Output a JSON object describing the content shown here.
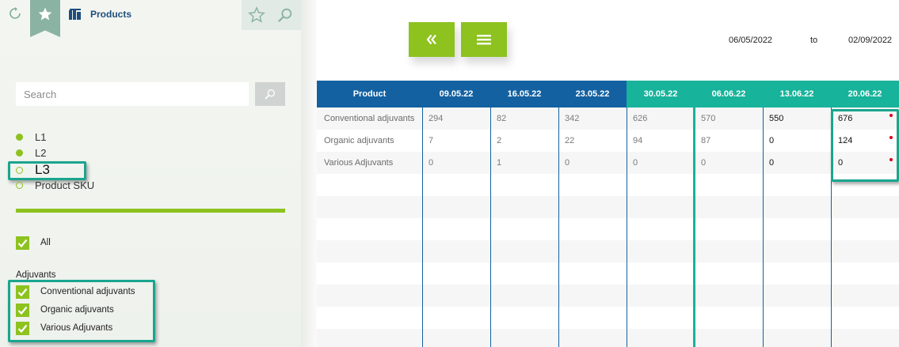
{
  "header": {
    "title": "Products",
    "refresh_icon": "refresh-icon",
    "favorite_icon": "star-icon",
    "products_icon": "products-icon",
    "star_outline_icon": "star-outline-icon",
    "search_icon": "search-icon"
  },
  "search": {
    "placeholder": "Search",
    "value": ""
  },
  "levels": [
    {
      "label": "L1",
      "selected": false
    },
    {
      "label": "L2",
      "selected": false
    },
    {
      "label": "L3",
      "selected": true
    },
    {
      "label": "Product SKU",
      "selected": false
    }
  ],
  "filters": {
    "all_label": "All",
    "group_label": "Adjuvants",
    "items": [
      {
        "label": "Conventional adjuvants",
        "checked": true
      },
      {
        "label": "Organic adjuvants",
        "checked": true
      },
      {
        "label": "Various Adjuvants",
        "checked": true
      }
    ]
  },
  "toolbar": {
    "collapse_icon": "double-chevron-left-icon",
    "menu_icon": "menu-icon"
  },
  "date_range": {
    "from": "06/05/2022",
    "separator": "to",
    "to": "02/09/2022"
  },
  "table": {
    "headers": [
      "Product",
      "09.05.22",
      "16.05.22",
      "23.05.22",
      "30.05.22",
      "06.06.22",
      "13.06.22",
      "20.06.22"
    ],
    "rows": [
      {
        "name": "Conventional adjuvants",
        "values": [
          "294",
          "82",
          "342",
          "626",
          "570",
          "550",
          "676"
        ]
      },
      {
        "name": "Organic adjuvants",
        "values": [
          "7",
          "2",
          "22",
          "94",
          "87",
          "0",
          "124"
        ]
      },
      {
        "name": "Various Adjuvants",
        "values": [
          "0",
          "1",
          "0",
          "0",
          "0",
          "0",
          "0"
        ]
      }
    ]
  },
  "colors": {
    "accent_green": "#8dc21f",
    "header_blue": "#1361a1",
    "header_teal": "#17b39a",
    "highlight": "#1aa58f"
  }
}
